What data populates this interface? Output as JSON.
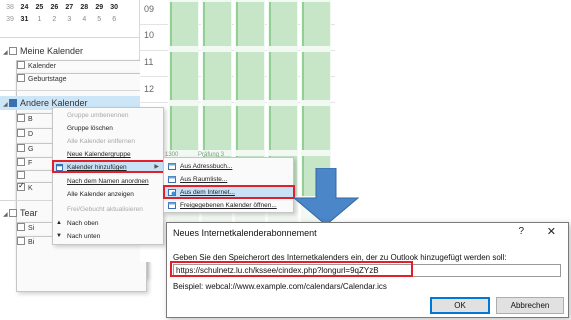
{
  "mini_calendar": {
    "rows": [
      {
        "week": "38",
        "days": [
          "24",
          "25",
          "26",
          "27",
          "28",
          "29",
          "30"
        ]
      },
      {
        "week": "39",
        "days": [
          "31",
          "1",
          "2",
          "3",
          "4",
          "5",
          "6"
        ]
      }
    ]
  },
  "sidebar": {
    "group1": {
      "label": "Meine Kalender",
      "items": [
        {
          "label": "Kalender",
          "checked": false
        },
        {
          "label": "Geburtstage",
          "checked": false
        }
      ]
    },
    "group2": {
      "label": "Andere Kalender",
      "items": [
        {
          "label": "B",
          "checked": false
        },
        {
          "label": "D",
          "checked": false
        },
        {
          "label": "G",
          "checked": false
        },
        {
          "label": "F",
          "checked": false
        },
        {
          "label": "",
          "checked": false
        },
        {
          "label": "K",
          "checked": true
        }
      ]
    },
    "group3": {
      "label": "Tear",
      "items": [
        {
          "label": "Si",
          "checked": false
        },
        {
          "label": "Bi",
          "checked": false
        }
      ]
    }
  },
  "calendar_grid": {
    "hours": [
      "09",
      "10",
      "11",
      "12"
    ]
  },
  "context_menu": {
    "items": [
      {
        "label": "Gruppe umbenennen",
        "disabled": true
      },
      {
        "label": "Gruppe löschen",
        "disabled": false
      },
      {
        "label": "Alle Kalender entfernen",
        "disabled": true
      },
      {
        "label": "Neue Kalendergruppe",
        "disabled": false
      },
      {
        "label": "Kalender hinzufügen",
        "disabled": false,
        "highlighted": true
      },
      {
        "label": "Nach dem Namen anordnen",
        "disabled": false
      },
      {
        "label": "Alle Kalender anzeigen",
        "disabled": false
      },
      {
        "label": "Frei/Gebucht aktualisieren",
        "disabled": true
      },
      {
        "label": "Nach oben",
        "disabled": false
      },
      {
        "label": "Nach unten",
        "disabled": false
      }
    ]
  },
  "submenu": {
    "items": [
      {
        "label": "Aus Adressbuch..."
      },
      {
        "label": "Aus Raumliste..."
      },
      {
        "label": "Aus dem Internet...",
        "highlighted": true
      },
      {
        "label": "Freigegebenen Kalender öffnen..."
      }
    ]
  },
  "calendar_snippets": [
    "1300",
    "Präfung 3"
  ],
  "dialog": {
    "title": "Neues Internetkalenderabonnement",
    "help": "?",
    "close": "✕",
    "prompt": "Geben Sie den Speicherort des Internetkalenders ein, der zu Outlook hinzugefügt werden soll:",
    "url_value": "https://schulnetz.lu.ch/kssee/cindex.php?longurl=9qZYzB",
    "example": "Beispiel: webcal://www.example.com/calendars/Calendar.ics",
    "ok_label": "OK",
    "cancel_label": "Abbrechen"
  },
  "colors": {
    "highlight_red": "#e0202a",
    "arrow_blue": "#4a86c8",
    "appointment_green": "#c7e6c8",
    "menu_hover": "#c9e1f5"
  }
}
